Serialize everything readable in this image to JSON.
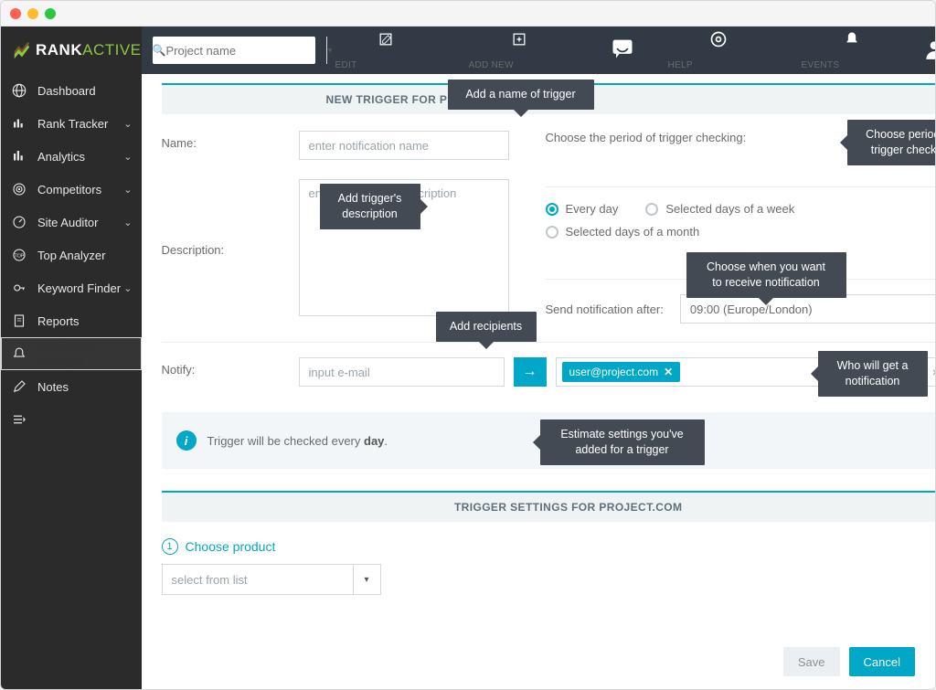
{
  "logo": {
    "brand_a": "RANK",
    "brand_b": "ACTIVE"
  },
  "sidebar": {
    "items": [
      {
        "label": "Dashboard",
        "expandable": false
      },
      {
        "label": "Rank Tracker",
        "expandable": true
      },
      {
        "label": "Analytics",
        "expandable": true
      },
      {
        "label": "Competitors",
        "expandable": true
      },
      {
        "label": "Site Auditor",
        "expandable": true
      },
      {
        "label": "Top Analyzer",
        "expandable": false
      },
      {
        "label": "Keyword Finder",
        "expandable": true
      },
      {
        "label": "Reports",
        "expandable": false
      },
      {
        "label": "Notification Manager",
        "expandable": false
      },
      {
        "label": "Notes",
        "expandable": false
      }
    ]
  },
  "topbar": {
    "project_placeholder": "Project name",
    "edit": "EDIT",
    "add_new": "ADD NEW",
    "help": "HELP",
    "events": "EVENTS",
    "user": "user"
  },
  "section1_title": "NEW TRIGGER FOR PROJECT.COM",
  "form": {
    "name_label": "Name:",
    "name_placeholder": "enter notification name",
    "desc_label": "Description:",
    "desc_placeholder": "enter notification description",
    "period_label": "Choose the period of trigger checking:",
    "radios": {
      "every_day": "Every day",
      "days_week": "Selected days of a week",
      "days_month": "Selected days of a month"
    },
    "send_after_label": "Send notification after:",
    "send_after_value": "09:00 (Europe/London)",
    "notify_label": "Notify:",
    "notify_placeholder": "input e-mail",
    "recipient_chip": "user@project.com"
  },
  "info_text_a": "Trigger will be checked every ",
  "info_text_b": "day",
  "info_text_c": ".",
  "section2_title": "TRIGGER SETTINGS FOR PROJECT.COM",
  "step1": {
    "num": "1",
    "label": "Choose product",
    "placeholder": "select from list"
  },
  "buttons": {
    "save": "Save",
    "cancel": "Cancel"
  },
  "callouts": {
    "name": "Add a name of trigger",
    "desc": "Add trigger's\ndescription",
    "period": "Choose period for\ntrigger checking",
    "when": "Choose when you want\nto receive notification",
    "recip": "Add recipients",
    "who": "Who will get a\nnotification",
    "estimate": "Estimate settings you've\nadded for a trigger"
  }
}
